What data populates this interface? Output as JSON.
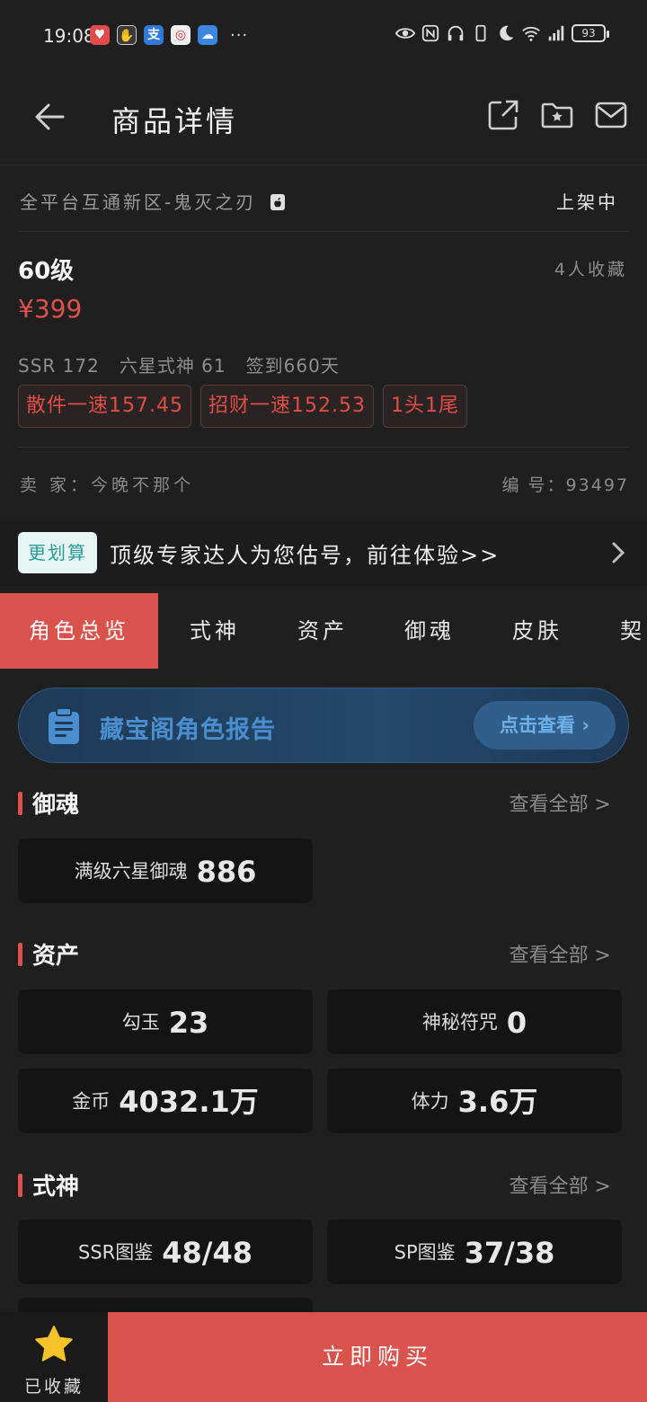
{
  "status_bar": {
    "time": "19:08",
    "battery": "93",
    "app_icons": [
      "health-app-icon",
      "hand-app-icon",
      "alipay-icon",
      "camera-app-icon",
      "cloud-app-icon"
    ],
    "more": "···"
  },
  "header": {
    "title": "商品详情"
  },
  "info": {
    "server": "全平台互通新区-鬼灭之刃",
    "status": "上架中",
    "level": "60级",
    "favorites": "4人收藏",
    "price": "¥399",
    "stats": [
      "SSR 172",
      "六星式神 61",
      "签到660天"
    ],
    "tags": [
      "散件一速157.45",
      "招财一速152.53",
      "1头1尾"
    ],
    "seller": "卖 家：今晚不那个",
    "serial": "编 号：93497"
  },
  "promo": {
    "badge": "更划算",
    "text": "顶级专家达人为您估号，前往体验>>"
  },
  "tabs": [
    "角色总览",
    "式神",
    "资产",
    "御魂",
    "皮肤",
    "契"
  ],
  "report": {
    "title": "藏宝阁角色报告",
    "button": "点击查看 ›"
  },
  "sections": {
    "yuhun": {
      "title": "御魂",
      "more": "查看全部 >",
      "cards": [
        {
          "label": "满级六星御魂",
          "value": "886"
        }
      ]
    },
    "assets": {
      "title": "资产",
      "more": "查看全部 >",
      "cards": [
        {
          "label": "勾玉",
          "value": "23"
        },
        {
          "label": "神秘符咒",
          "value": "0"
        },
        {
          "label": "金币",
          "value": "4032.1万"
        },
        {
          "label": "体力",
          "value": "3.6万"
        }
      ]
    },
    "shikigami": {
      "title": "式神",
      "more": "查看全部 >",
      "cards": [
        {
          "label": "SSR图鉴",
          "value": "48/48"
        },
        {
          "label": "SP图鉴",
          "value": "37/38"
        }
      ]
    }
  },
  "bottom": {
    "fav_label": "已收藏",
    "buy_label": "立即购买"
  },
  "colors": {
    "accent": "#d9534c",
    "background": "#1f1f1f",
    "card": "#141414",
    "price": "#e15149"
  }
}
